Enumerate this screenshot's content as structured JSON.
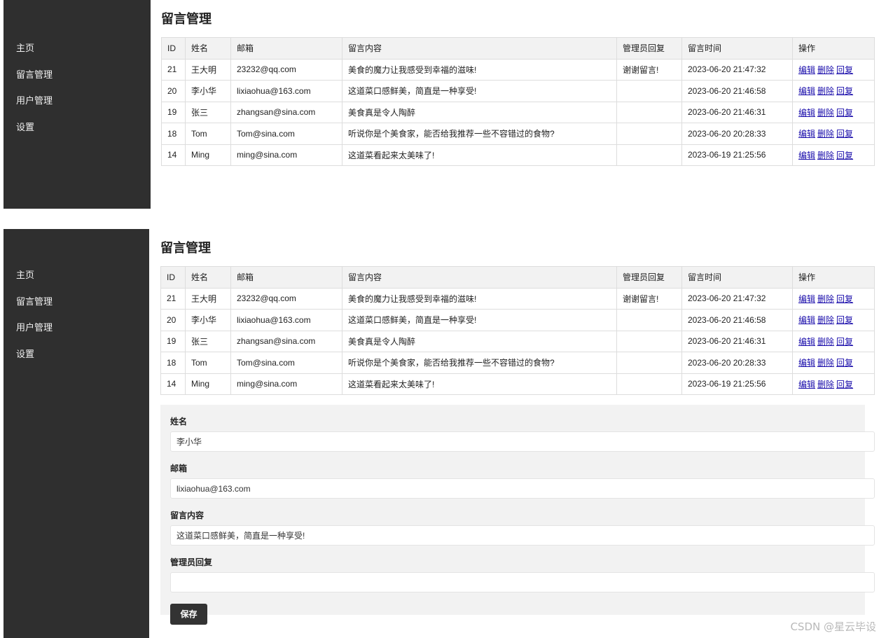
{
  "sidebar": {
    "items": [
      {
        "label": "主页"
      },
      {
        "label": "留言管理"
      },
      {
        "label": "用户管理"
      },
      {
        "label": "设置"
      }
    ]
  },
  "page_title": "留言管理",
  "table": {
    "headers": [
      "ID",
      "姓名",
      "邮箱",
      "留言内容",
      "管理员回复",
      "留言时间",
      "操作"
    ],
    "rows": [
      {
        "id": "21",
        "name": "王大明",
        "email": "23232@qq.com",
        "content": "美食的魔力让我感受到幸福的滋味!",
        "reply": "谢谢留言!",
        "time": "2023-06-20 21:47:32"
      },
      {
        "id": "20",
        "name": "李小华",
        "email": "lixiaohua@163.com",
        "content": "这道菜口感鲜美，简直是一种享受!",
        "reply": "",
        "time": "2023-06-20 21:46:58"
      },
      {
        "id": "19",
        "name": "张三",
        "email": "zhangsan@sina.com",
        "content": "美食真是令人陶醉",
        "reply": "",
        "time": "2023-06-20 21:46:31"
      },
      {
        "id": "18",
        "name": "Tom",
        "email": "Tom@sina.com",
        "content": "听说你是个美食家，能否给我推荐一些不容错过的食物?",
        "reply": "",
        "time": "2023-06-20 20:28:33"
      },
      {
        "id": "14",
        "name": "Ming",
        "email": "ming@sina.com",
        "content": "这道菜看起来太美味了!",
        "reply": "",
        "time": "2023-06-19 21:25:56"
      }
    ],
    "actions": {
      "edit": "编辑",
      "delete": "删除",
      "reply": "回复"
    }
  },
  "form": {
    "name_label": "姓名",
    "name_value": "李小华",
    "email_label": "邮箱",
    "email_value": "lixiaohua@163.com",
    "content_label": "留言内容",
    "content_value": "这道菜口感鲜美，简直是一种享受!",
    "reply_label": "管理员回复",
    "reply_value": "",
    "save_label": "保存"
  },
  "watermark": "CSDN @星云毕设"
}
